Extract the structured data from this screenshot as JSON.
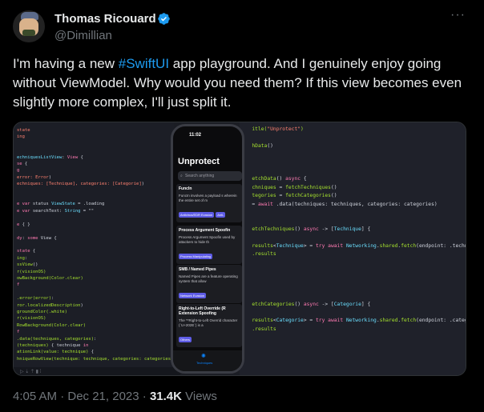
{
  "author": {
    "name": "Thomas Ricouard",
    "handle": "@Dimillian"
  },
  "tweet": {
    "text_before": "I'm having a new ",
    "hashtag": "#SwiftUI",
    "text_after": " app playground. And I genuinely enjoy going without ViewModel. Why would you need them? If this view becomes even slightly more complex, I'll just split it."
  },
  "menu": {
    "more_label": "···"
  },
  "phone": {
    "time": "11:02",
    "title": "Unprotect",
    "search_placeholder": "Search anything",
    "items": [
      {
        "heading": "FuncIn",
        "desc": "FuncIn involves a payload s wherein the entire set of m",
        "tags": [
          "Antivirus/EDR Evasion",
          "Anti-"
        ]
      },
      {
        "heading": "Process Argument Spoofin",
        "desc": "Process Argument Spoofin used by attackers to hide th",
        "tags": [
          "Process Manipulating"
        ]
      },
      {
        "heading": "SMB / Named Pipes",
        "desc": "Named Pipes are a feature operating system that allow",
        "tags": [
          "Network Evasion"
        ]
      },
      {
        "heading": "Right-to-Left Override (R Extension Spoofing",
        "desc": "The **Right-to-Left Overrid character (`U+202E`) is a",
        "tags": [
          "Others"
        ]
      }
    ],
    "tab_label": "Techniques"
  },
  "footer": {
    "time": "4:05 AM · Dec 21, 2023 · ",
    "views_count": "31.4K",
    "views_label": " Views"
  },
  "colors": {
    "accent": "#1d9bf0",
    "background": "#000000",
    "muted": "#71767b"
  }
}
